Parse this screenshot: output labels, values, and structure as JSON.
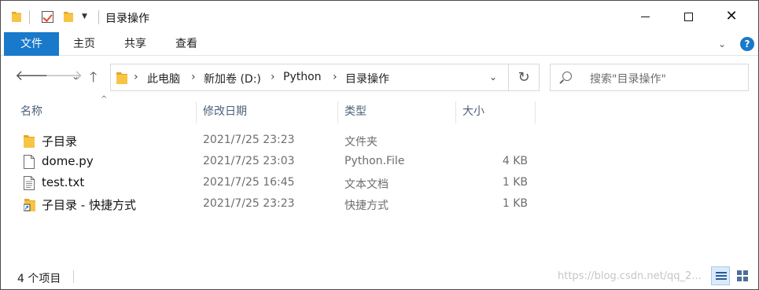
{
  "window": {
    "title": "目录操作",
    "controls": {
      "minimize": "minimize-icon",
      "maximize": "maximize-icon",
      "close": "close-icon"
    }
  },
  "ribbon": {
    "tabs": [
      "文件",
      "主页",
      "共享",
      "查看"
    ],
    "expand_icon": "chevron-down-icon",
    "help_label": "?"
  },
  "nav": {
    "back_icon": "arrow-left-icon",
    "forward_icon": "arrow-right-icon",
    "recent_icon": "chevron-down-icon",
    "up_icon": "arrow-up-icon",
    "breadcrumb": [
      "此电脑",
      "新加卷 (D:)",
      "Python",
      "目录操作"
    ],
    "refresh_icon": "refresh-icon"
  },
  "search": {
    "placeholder": "搜索\"目录操作\""
  },
  "columns": {
    "name": "名称",
    "date": "修改日期",
    "type": "类型",
    "size": "大小"
  },
  "files": [
    {
      "name": "子目录",
      "date": "2021/7/25 23:23",
      "type": "文件夹",
      "size": "",
      "icon": "folder-icon"
    },
    {
      "name": "dome.py",
      "date": "2021/7/25 23:03",
      "type": "Python.File",
      "size": "4 KB",
      "icon": "file-icon"
    },
    {
      "name": "test.txt",
      "date": "2021/7/25 16:45",
      "type": "文本文档",
      "size": "1 KB",
      "icon": "text-file-icon"
    },
    {
      "name": "子目录 - 快捷方式",
      "date": "2021/7/25 23:23",
      "type": "快捷方式",
      "size": "1 KB",
      "icon": "shortcut-icon"
    }
  ],
  "status": {
    "count": "4 个项目",
    "watermark": "https://blog.csdn.net/qq_2..."
  },
  "colors": {
    "accent": "#1979ca",
    "header_text": "#4c607a",
    "secondary_text": "#6d6d6d",
    "folder": "#f8c444"
  }
}
